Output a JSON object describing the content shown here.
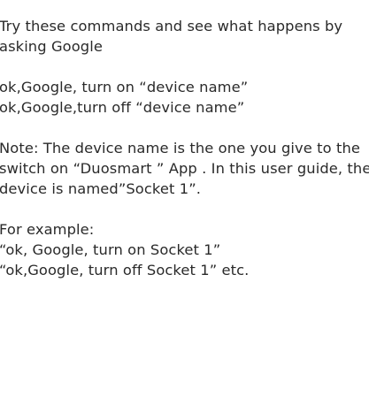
{
  "intro": {
    "lines": [
      "Try these commands and see what happens by",
      "asking Google"
    ]
  },
  "commands": {
    "lines": [
      "ok,Google, turn on “device name”",
      "ok,Google,turn off “device name”"
    ]
  },
  "note": {
    "lines": [
      "Note: The device name is the one you give to the",
      "switch on “Duosmart ” App . In this user guide, the",
      "device is named”Socket 1”."
    ]
  },
  "example": {
    "lines": [
      "For example:",
      "“ok, Google, turn on  Socket 1”",
      "“ok,Google, turn off  Socket 1” etc."
    ]
  }
}
